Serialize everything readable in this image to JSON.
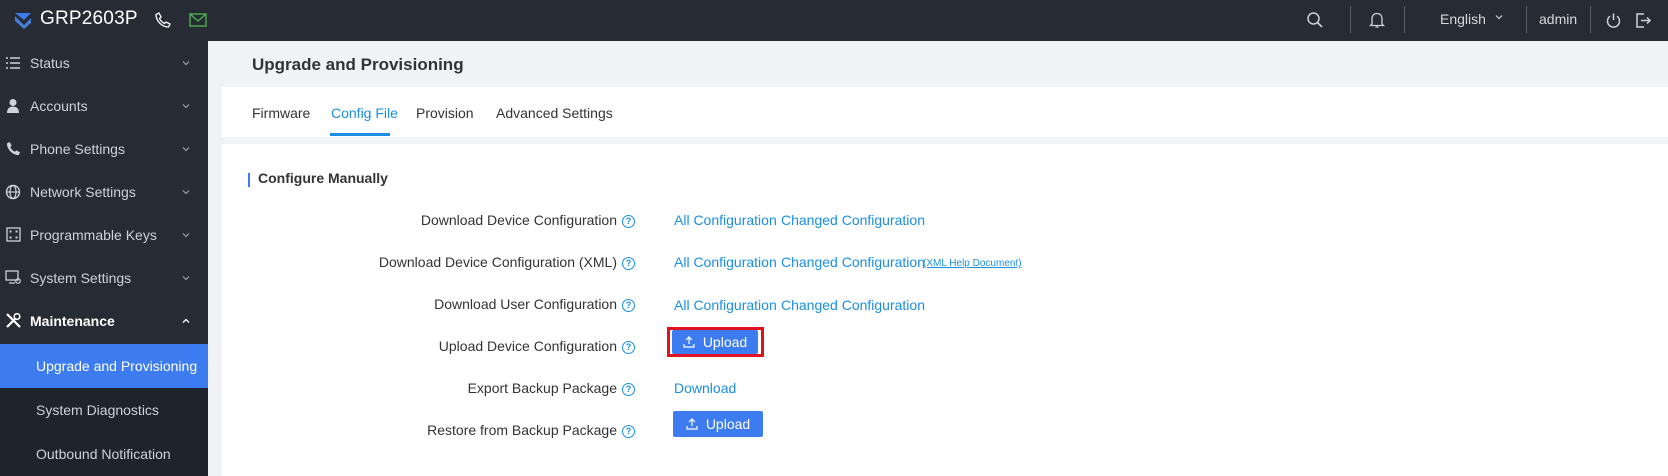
{
  "topbar": {
    "brand": "GRP2603P",
    "language": "English",
    "user": "admin",
    "icons": [
      "phone-icon",
      "mail-icon",
      "search-icon",
      "bell-icon",
      "power-icon",
      "logout-icon"
    ]
  },
  "sidebar": {
    "items": [
      {
        "label": "Status",
        "icon": "list-icon"
      },
      {
        "label": "Accounts",
        "icon": "person-icon"
      },
      {
        "label": "Phone Settings",
        "icon": "phone-icon"
      },
      {
        "label": "Network Settings",
        "icon": "globe-icon"
      },
      {
        "label": "Programmable Keys",
        "icon": "keypad-icon"
      },
      {
        "label": "System Settings",
        "icon": "monitor-icon"
      },
      {
        "label": "Maintenance",
        "icon": "tools-icon"
      }
    ],
    "subitems": [
      {
        "label": "Upgrade and Provisioning"
      },
      {
        "label": "System Diagnostics"
      },
      {
        "label": "Outbound Notification"
      }
    ]
  },
  "page": {
    "title": "Upgrade and Provisioning",
    "tabs": [
      {
        "label": "Firmware"
      },
      {
        "label": "Config File"
      },
      {
        "label": "Provision"
      },
      {
        "label": "Advanced Settings"
      }
    ],
    "active_tab": "Config File"
  },
  "section": {
    "title": "Configure Manually",
    "rows": [
      {
        "label": "Download Device Configuration",
        "links": [
          "All Configuration",
          "Changed Configuration"
        ]
      },
      {
        "label": "Download Device Configuration (XML)",
        "links": [
          "All Configuration",
          "Changed Configuration"
        ],
        "extra": "(XML Help Document)"
      },
      {
        "label": "Download User Configuration",
        "links": [
          "All Configuration",
          "Changed Configuration"
        ]
      },
      {
        "label": "Upload Device Configuration",
        "button": "Upload"
      },
      {
        "label": "Export Backup Package",
        "links": [
          "Download"
        ]
      },
      {
        "label": "Restore from Backup Package",
        "button": "Upload"
      }
    ]
  },
  "colors": {
    "accent": "#3c7cf0",
    "link": "#1a8fe3",
    "sidebar_bg": "#272b34",
    "highlight": "#e0121f"
  }
}
